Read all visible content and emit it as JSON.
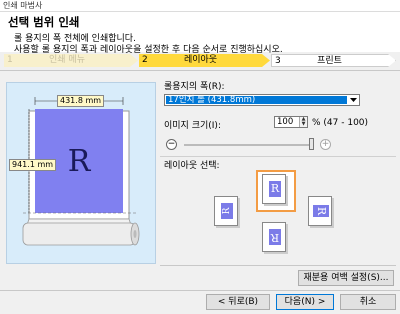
{
  "window": {
    "title": "인쇄 마법사"
  },
  "header": {
    "title": "선택 범위 인쇄",
    "desc_line1": "롤 용지의 폭 전체에 인쇄합니다.",
    "desc_line2": "사용할 롤 용지의 폭과 레이아웃을 설정한 후 다음 순서로 진행하십시오."
  },
  "steps": [
    {
      "num": "1",
      "label": "인쇄 메뉴",
      "state": "done"
    },
    {
      "num": "2",
      "label": "레이아웃",
      "state": "current"
    },
    {
      "num": "3",
      "label": "프린트",
      "state": "todo"
    }
  ],
  "preview": {
    "width_label": "431.8 mm",
    "height_label": "941.1 mm",
    "letter": "R",
    "fill_color": "#8080f0"
  },
  "settings": {
    "roll_width_label": "롤용지의 폭(R):",
    "roll_width_value": "17인치 롤 (431.8mm)",
    "image_size_label": "이미지 크기(I):",
    "image_size_value": "100",
    "image_size_unit": "% (47 - 100)",
    "zoom_level_fraction": 1.0,
    "layout_label": "레이아웃 선택:",
    "layout_letter": "R",
    "layout_selected": "top-center",
    "margin_button": "재분용 여백 설정(S)..."
  },
  "footer": {
    "back": "< 뒤로(B)",
    "next": "다음(N) >",
    "cancel": "취소"
  }
}
